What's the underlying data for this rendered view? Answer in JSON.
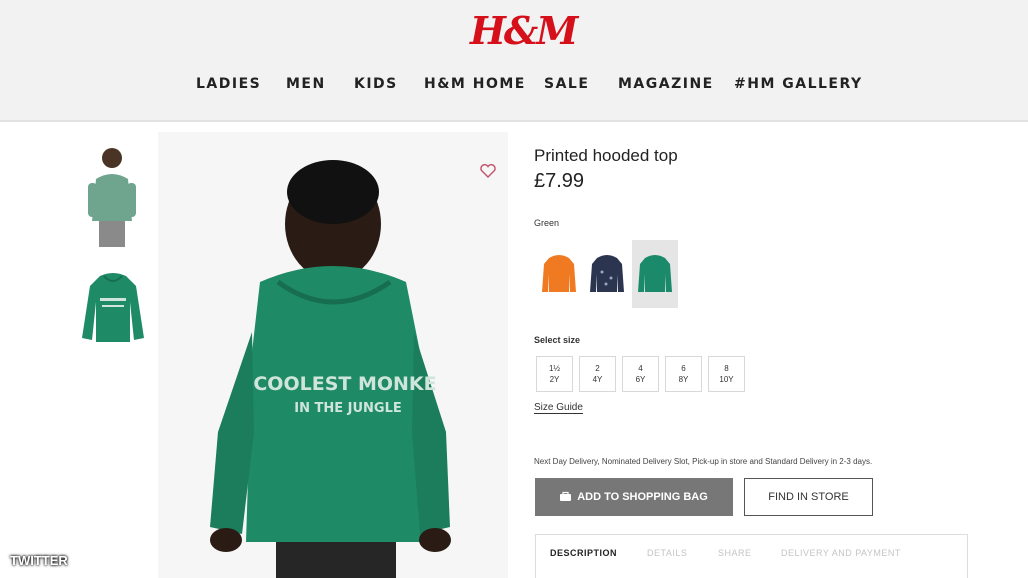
{
  "header": {
    "logo": "H&M",
    "nav": [
      "LADIES",
      "MEN",
      "KIDS",
      "H&M HOME",
      "SALE",
      "MAGAZINE",
      "#HM GALLERY"
    ]
  },
  "product": {
    "title": "Printed hooded top",
    "price": "£7.99",
    "color_label": "Green",
    "hoodie_print_line1": "COOLEST MONKE",
    "hoodie_print_line2": "IN THE JUNGLE",
    "swatches": [
      {
        "name": "orange",
        "color": "#f07a22"
      },
      {
        "name": "navy",
        "color": "#2c3550"
      },
      {
        "name": "green",
        "color": "#1a8a6a",
        "selected": true
      }
    ],
    "size_label": "Select size",
    "sizes": [
      {
        "top": "1½",
        "bottom": "2Y"
      },
      {
        "top": "2",
        "bottom": "4Y"
      },
      {
        "top": "4",
        "bottom": "6Y"
      },
      {
        "top": "6",
        "bottom": "8Y"
      },
      {
        "top": "8",
        "bottom": "10Y"
      }
    ],
    "size_guide": "Size Guide",
    "delivery": "Next Day Delivery, Nominated Delivery Slot, Pick-up in store and Standard Delivery in 2-3 days.",
    "add_to_bag": "ADD TO SHOPPING BAG",
    "find_in_store": "FIND IN STORE",
    "tabs": [
      "DESCRIPTION",
      "DETAILS",
      "SHARE",
      "DELIVERY AND PAYMENT"
    ]
  },
  "watermark": "TWITTER",
  "colors": {
    "brand": "#d5101a",
    "hoodie": "#1f8a66",
    "button_gray": "#777777"
  }
}
